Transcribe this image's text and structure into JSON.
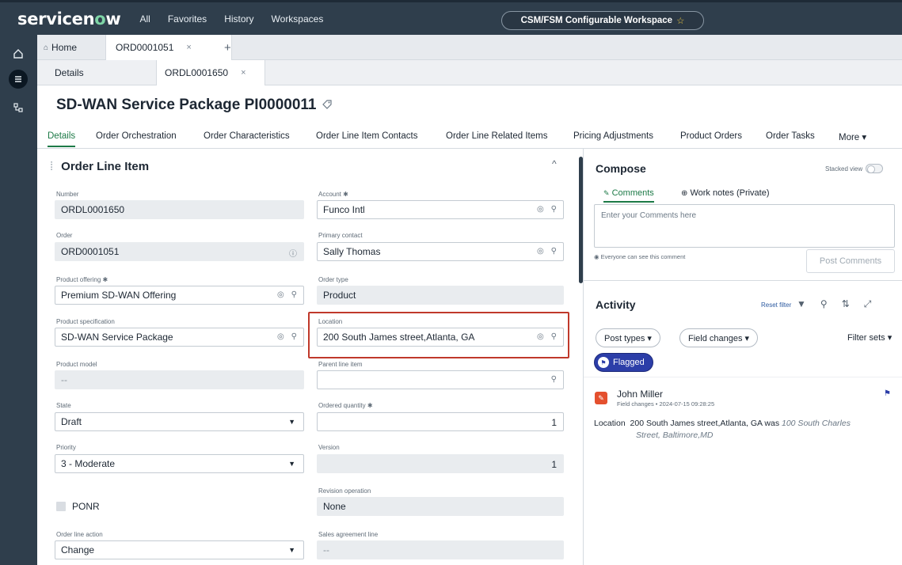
{
  "header": {
    "logo_text": "servicen",
    "logo_o": "o",
    "logo_w": "w",
    "nav": [
      "All",
      "Favorites",
      "History",
      "Workspaces"
    ],
    "workspace": "CSM/FSM Configurable Workspace",
    "workspace_star": "☆"
  },
  "tabs1": {
    "home": "Home",
    "order": "ORD0001051",
    "close": "×",
    "add": "+"
  },
  "tabs2": {
    "details": "Details",
    "line": "ORDL0001650",
    "close": "×"
  },
  "record": {
    "title": "SD-WAN Service Package PI0000011"
  },
  "record_tabs": [
    "Details",
    "Order Orchestration",
    "Order Characteristics",
    "Order Line Item Contacts",
    "Order Line Related Items",
    "Pricing Adjustments",
    "Product Orders",
    "Order Tasks",
    "More ▾"
  ],
  "section": {
    "title": "Order Line Item",
    "collapse": "^"
  },
  "fields": {
    "number": {
      "label": "Number",
      "value": "ORDL0001650"
    },
    "account": {
      "label": "Account ✱",
      "value": "Funco Intl"
    },
    "order": {
      "label": "Order",
      "value": "ORD0001051"
    },
    "primary_contact": {
      "label": "Primary contact",
      "value": "Sally Thomas"
    },
    "product_offering": {
      "label": "Product offering ✱",
      "value": "Premium SD-WAN Offering"
    },
    "order_type": {
      "label": "Order type",
      "value": "Product"
    },
    "product_specification": {
      "label": "Product specification",
      "value": "SD-WAN Service Package"
    },
    "location": {
      "label": "Location",
      "value": "200 South James street,Atlanta, GA"
    },
    "product_model": {
      "label": "Product model",
      "value": "--"
    },
    "parent_line_item": {
      "label": "Parent line item",
      "value": ""
    },
    "state": {
      "label": "State",
      "value": "Draft"
    },
    "ordered_quantity": {
      "label": "Ordered quantity ✱",
      "value": "1"
    },
    "priority": {
      "label": "Priority",
      "value": "3 - Moderate"
    },
    "version": {
      "label": "Version",
      "value": "1"
    },
    "revision_operation": {
      "label": "Revision operation",
      "value": "None"
    },
    "ponr": {
      "label": "PONR"
    },
    "order_line_action": {
      "label": "Order line action",
      "value": "Change"
    },
    "sales_agreement_line": {
      "label": "Sales agreement line",
      "value": "--"
    }
  },
  "compose": {
    "title": "Compose",
    "stacked_view": "Stacked view",
    "tab_comments": "Comments",
    "tab_work_notes": "Work notes (Private)",
    "placeholder": "Enter your Comments here",
    "visibility": "Everyone can see this comment",
    "post_button": "Post Comments"
  },
  "activity": {
    "title": "Activity",
    "reset_filter": "Reset filter",
    "post_types": "Post types ▾",
    "field_changes": "Field changes ▾",
    "filter_sets": "Filter sets ▾",
    "flagged": "Flagged",
    "entry": {
      "author": "John Miller",
      "meta": "Field changes • 2024-07-15 09:28:25",
      "field": "Location",
      "new_value": "200 South James street,Atlanta, GA was",
      "old_value_1": "100 South Charles",
      "old_value_2": "Street, Baltimore,MD"
    }
  },
  "colors": {
    "header_bg": "#2f3e4c",
    "accent_green": "#1d7a47",
    "highlight_red": "#c0392b",
    "flag_blue": "#2c3ea8"
  }
}
